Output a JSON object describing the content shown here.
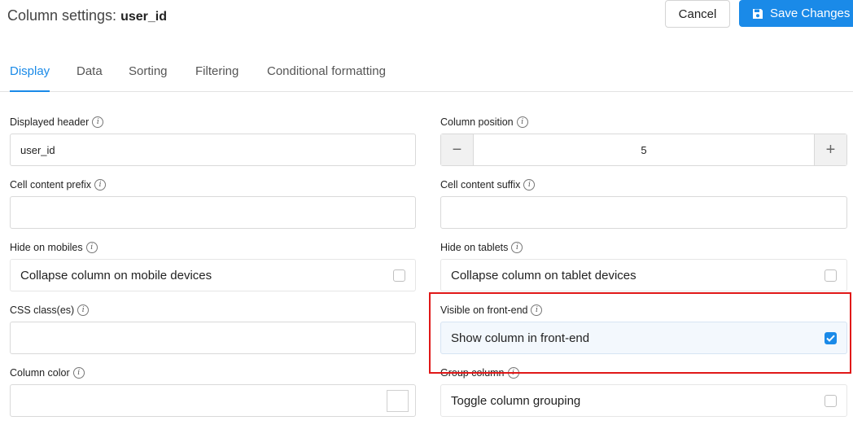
{
  "header": {
    "title_prefix": "Column settings: ",
    "title_column": "user_id",
    "cancel_label": "Cancel",
    "save_label": "Save Changes"
  },
  "tabs": [
    {
      "label": "Display",
      "active": true
    },
    {
      "label": "Data"
    },
    {
      "label": "Sorting"
    },
    {
      "label": "Filtering"
    },
    {
      "label": "Conditional formatting"
    }
  ],
  "form": {
    "displayed_header": {
      "label": "Displayed header",
      "value": "user_id"
    },
    "column_position": {
      "label": "Column position",
      "value": "5"
    },
    "cell_prefix": {
      "label": "Cell content prefix",
      "value": ""
    },
    "cell_suffix": {
      "label": "Cell content suffix",
      "value": ""
    },
    "hide_mobiles": {
      "label": "Hide on mobiles",
      "text": "Collapse column on mobile devices",
      "checked": false
    },
    "hide_tablets": {
      "label": "Hide on tablets",
      "text": "Collapse column on tablet devices",
      "checked": false
    },
    "css_classes": {
      "label": "CSS class(es)",
      "value": ""
    },
    "visible_frontend": {
      "label": "Visible on front-end",
      "text": "Show column in front-end",
      "checked": true
    },
    "column_color": {
      "label": "Column color",
      "value": ""
    },
    "group_column": {
      "label": "Group column",
      "text": "Toggle column grouping",
      "checked": false
    }
  },
  "icons": {
    "info": "i",
    "minus": "−",
    "plus": "+"
  },
  "colors": {
    "accent": "#1a8ae8",
    "highlight_border": "#e01818"
  }
}
